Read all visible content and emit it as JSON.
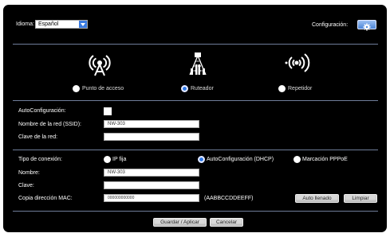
{
  "header": {
    "language_label": "Idioma:",
    "language_value": "Español",
    "config_label": "Configuración:",
    "config_icon": "gear-icon"
  },
  "modes": {
    "items": [
      {
        "label": "Punto de acceso",
        "icon": "access-point-icon",
        "selected": false
      },
      {
        "label": "Ruteador",
        "icon": "router-icon",
        "selected": true
      },
      {
        "label": "Repetidor",
        "icon": "repeater-icon",
        "selected": false
      }
    ]
  },
  "wireless": {
    "autoconfig_label": "AutoConfiguración:",
    "ssid_label": "Nombre de la red (SSID):",
    "ssid_value": "NW-303",
    "key_label": "Clave de la red:",
    "key_value": ""
  },
  "connection": {
    "type_label": "Tipo de conexión:",
    "options": [
      {
        "label": "IP fija",
        "selected": false
      },
      {
        "label": "AutoConfiguración (DHCP)",
        "selected": true
      },
      {
        "label": "Marcación PPPoE",
        "selected": false
      }
    ],
    "name_label": "Nombre:",
    "name_value": "NW-303",
    "password_label": "Clave:",
    "password_value": "",
    "mac_label": "Copia dirección MAC:",
    "mac_value": "000000000000",
    "mac_hint": "(AABBCCDDEEFF)",
    "autofill_label": "Auto llenado",
    "clear_label": "Limpiar"
  },
  "footer": {
    "save_label": "Guardar / Aplicar",
    "cancel_label": "Cancelar"
  },
  "colors": {
    "panel": "#000000",
    "accent": "#2f78e8",
    "divider": "#6f7d9a"
  }
}
